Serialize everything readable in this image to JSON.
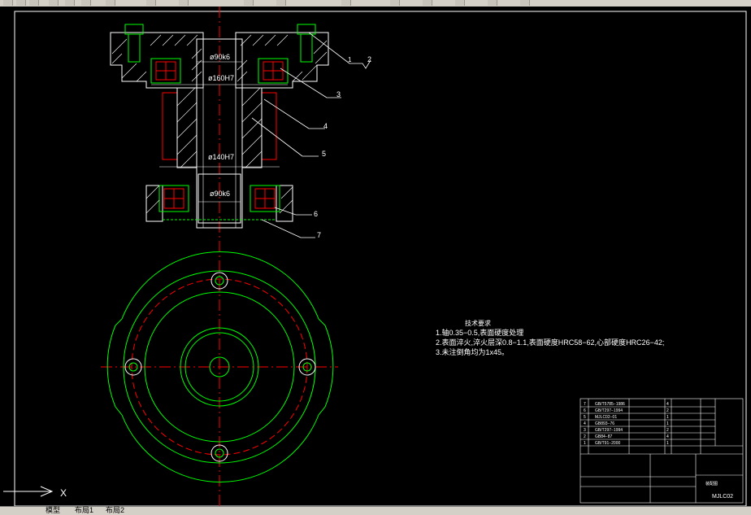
{
  "dimensions": {
    "d1": "ø90k6",
    "d2": "ø160H7",
    "d3": "ø140H7",
    "d4": "ø90k6"
  },
  "balloons": [
    "1",
    "2",
    "3",
    "4",
    "5",
    "6",
    "7"
  ],
  "notes": {
    "title": "技术要求",
    "lines": [
      "1.轴0.35−0.5,表面硬度处理",
      "2.表面淬火,淬火层深0.8−1.1,表面硬度HRC58−62,心部硬度HRC26−42;",
      "3.未注倒角均为1x45。"
    ]
  },
  "title_block": {
    "bom": [
      {
        "no": "7",
        "code": "GB/T5785−1986",
        "qty": "4"
      },
      {
        "no": "6",
        "code": "GB/T297−1994",
        "qty": "2"
      },
      {
        "no": "5",
        "code": "MJLC02−01",
        "qty": "1"
      },
      {
        "no": "4",
        "code": "GB893−76",
        "qty": "1"
      },
      {
        "no": "3",
        "code": "GB/T297−1994",
        "qty": "2"
      },
      {
        "no": "2",
        "code": "GB84−87",
        "qty": "4"
      },
      {
        "no": "1",
        "code": "GB/T91−2000",
        "qty": "1"
      }
    ],
    "drawing_no": "MJLC02",
    "assembly_label": "装配图"
  },
  "statusbar": {
    "tab_model": "模型",
    "tab_layout1": "布局1",
    "tab_layout2": "布局2"
  },
  "ucs_label": "X",
  "colors": {
    "green": "#00ff00",
    "white": "#ffffff",
    "red": "#ff0000",
    "cyan": "#00ffff"
  }
}
